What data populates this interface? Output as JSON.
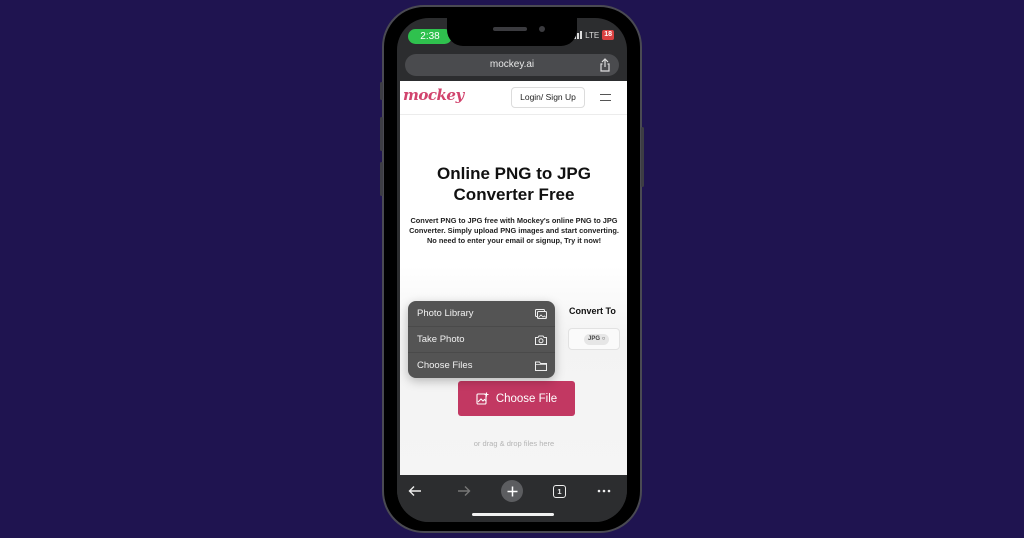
{
  "status_bar": {
    "time": "2:38",
    "network": "LTE",
    "battery": "18"
  },
  "browser": {
    "url": "mockey.ai",
    "toolbar": {
      "back": "back",
      "forward": "forward",
      "new_tab": "new-tab",
      "tab_count": "1",
      "more": "more"
    }
  },
  "site": {
    "logo_text": "mockey",
    "login_label": "Login/ Sign Up",
    "hero_title_line1": "Online PNG to JPG",
    "hero_title_line2": "Converter Free",
    "hero_description": "Convert PNG to JPG free with Mockey's  online PNG to JPG Converter. Simply upload PNG images and start converting. No need to enter your email or signup, Try it now!",
    "convert_to_label": "Convert To",
    "format_selected": "JPG",
    "choose_file_label": "Choose File",
    "drop_hint": "or drag & drop files here"
  },
  "file_picker_menu": {
    "items": [
      {
        "label": "Photo Library",
        "icon": "photo-library-icon"
      },
      {
        "label": "Take Photo",
        "icon": "camera-icon"
      },
      {
        "label": "Choose Files",
        "icon": "folder-icon"
      }
    ]
  },
  "colors": {
    "background": "#1f1450",
    "brand": "#c23862",
    "status_green": "#2fc14e"
  }
}
